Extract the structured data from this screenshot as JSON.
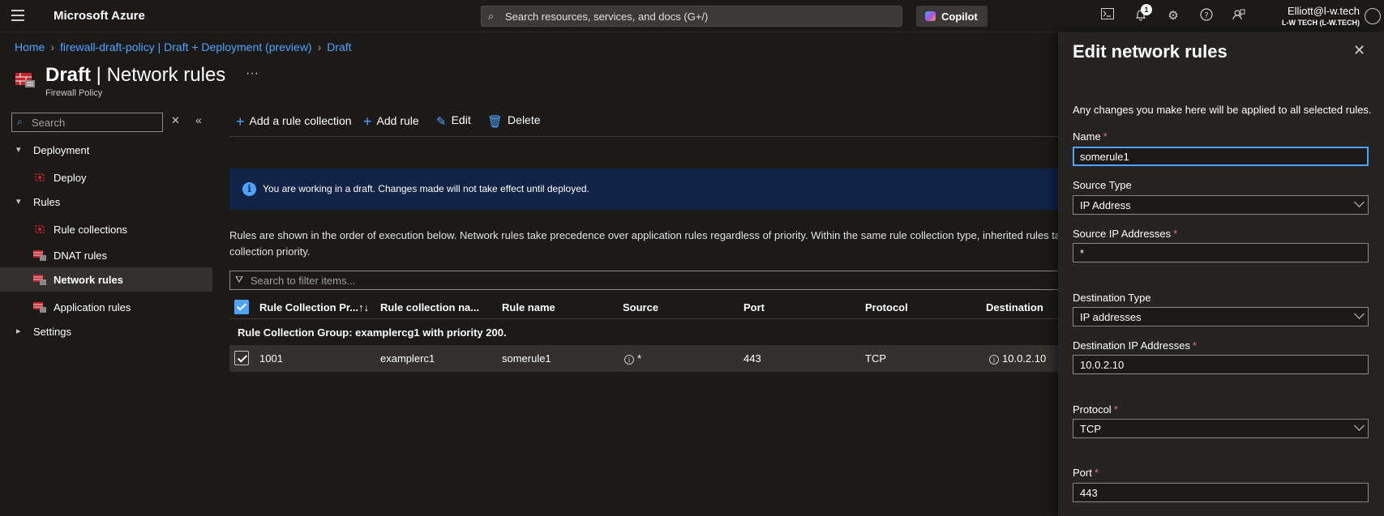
{
  "topbar": {
    "brand": "Microsoft Azure",
    "search_placeholder": "Search resources, services, and docs (G+/)",
    "copilot_label": "Copilot",
    "notification_count": "1",
    "user_name": "Elliott@l-w.tech",
    "user_tenant": "L-W TECH (L-W.TECH)"
  },
  "breadcrumb": {
    "items": [
      "Home",
      "firewall-draft-policy | Draft + Deployment (preview)",
      "Draft"
    ]
  },
  "header": {
    "title_bold": "Draft",
    "title_rest": " | Network rules",
    "subtitle": "Firewall Policy",
    "more": "···"
  },
  "nav": {
    "search_placeholder": "Search",
    "items": [
      {
        "label": "Deployment",
        "type": "group",
        "expanded": true
      },
      {
        "label": "Deploy",
        "type": "item"
      },
      {
        "label": "Rules",
        "type": "group",
        "expanded": true
      },
      {
        "label": "Rule collections",
        "type": "item"
      },
      {
        "label": "DNAT rules",
        "type": "item"
      },
      {
        "label": "Network rules",
        "type": "item",
        "active": true
      },
      {
        "label": "Application rules",
        "type": "item"
      },
      {
        "label": "Settings",
        "type": "group",
        "expanded": false
      }
    ]
  },
  "toolbar": {
    "add_collection": "Add a rule collection",
    "add_rule": "Add rule",
    "edit": "Edit",
    "delete": "Delete"
  },
  "banner": {
    "text": "You are working in a draft. Changes made will not take effect until deployed."
  },
  "description": {
    "line1": "Rules are shown in the order of execution below. Network rules take precedence over application rules regardless of priority. Within the same rule collection type, inherited rules take",
    "line2": "collection priority."
  },
  "filter": {
    "placeholder": "Search to filter items..."
  },
  "table": {
    "columns": [
      "Rule Collection Pr...↑↓",
      "Rule collection na...",
      "Rule name",
      "Source",
      "Port",
      "Protocol",
      "Destination"
    ],
    "group_label": "Rule Collection Group: examplercg1 with priority 200.",
    "rows": [
      {
        "priority": "1001",
        "collection": "examplerc1",
        "rule": "somerule1",
        "source": "*",
        "port": "443",
        "protocol": "TCP",
        "destination": "10.0.2.10",
        "selected": true
      }
    ]
  },
  "panel": {
    "title": "Edit network rules",
    "note": "Any changes you make here will be applied to all selected rules.",
    "fields": {
      "name_label": "Name",
      "name_value": "somerule1",
      "source_type_label": "Source Type",
      "source_type_value": "IP Address",
      "source_ips_label": "Source IP Addresses",
      "source_ips_value": "*",
      "dest_type_label": "Destination Type",
      "dest_type_value": "IP addresses",
      "dest_ips_label": "Destination IP Addresses",
      "dest_ips_value": "10.0.2.10",
      "protocol_label": "Protocol",
      "protocol_value": "TCP",
      "port_label": "Port",
      "port_value": "443"
    }
  },
  "colors": {
    "accent": "#4da3ff",
    "background": "#1b1a19",
    "banner": "#112448",
    "required": "#f1707b"
  }
}
